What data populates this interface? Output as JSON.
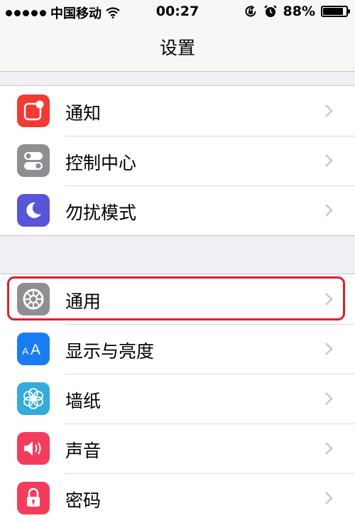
{
  "status_bar": {
    "carrier": "中国移动",
    "time": "00:27",
    "battery": "88%",
    "battery_level": 0.88
  },
  "nav": {
    "title": "设置"
  },
  "groups": [
    {
      "items": [
        {
          "label": "通知",
          "icon": "notifications-icon",
          "icon_color": "#f23a34"
        },
        {
          "label": "控制中心",
          "icon": "control-center-icon",
          "icon_color": "#8e8e93"
        },
        {
          "label": "勿扰模式",
          "icon": "moon-icon",
          "icon_color": "#5856d6"
        }
      ]
    },
    {
      "items": [
        {
          "label": "通用",
          "icon": "gear-icon",
          "icon_color": "#8e8e93",
          "highlighted": true
        },
        {
          "label": "显示与亮度",
          "icon": "display-brightness-icon",
          "icon_color": "#1a7cf5"
        },
        {
          "label": "墙纸",
          "icon": "wallpaper-flower-icon",
          "icon_color": "#35aadc"
        },
        {
          "label": "声音",
          "icon": "speaker-icon",
          "icon_color": "#f43d5c"
        },
        {
          "label": "密码",
          "icon": "lock-icon",
          "icon_color": "#f43d5c"
        }
      ]
    }
  ],
  "colors": {
    "highlight": "#d9222a",
    "background": "#efeff4"
  }
}
